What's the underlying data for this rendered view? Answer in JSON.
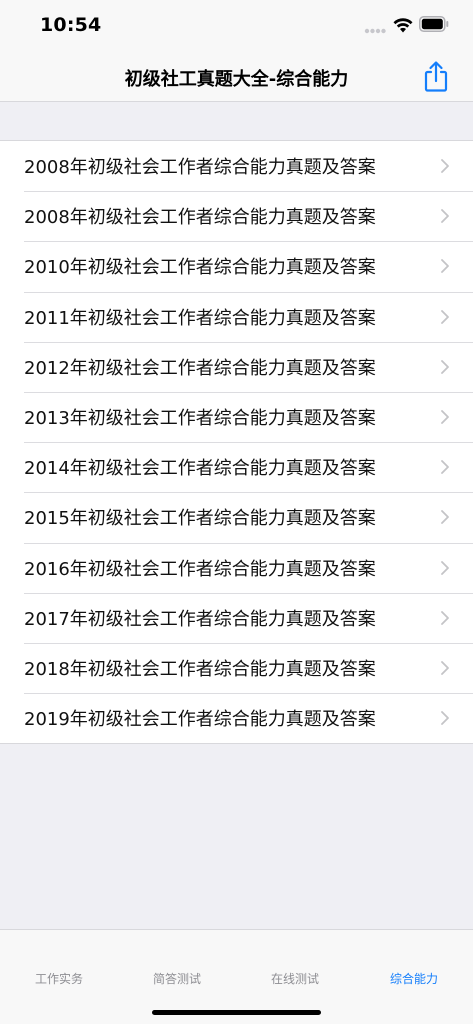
{
  "status_bar": {
    "time": "10:54"
  },
  "nav": {
    "title": "初级社工真题大全-综合能力",
    "share_icon": "share-icon",
    "accent_color": "#147efb"
  },
  "list": {
    "items": [
      {
        "label": "2008年初级社会工作者综合能力真题及答案"
      },
      {
        "label": "2008年初级社会工作者综合能力真题及答案"
      },
      {
        "label": "2010年初级社会工作者综合能力真题及答案"
      },
      {
        "label": "2011年初级社会工作者综合能力真题及答案"
      },
      {
        "label": "2012年初级社会工作者综合能力真题及答案"
      },
      {
        "label": "2013年初级社会工作者综合能力真题及答案"
      },
      {
        "label": "2014年初级社会工作者综合能力真题及答案"
      },
      {
        "label": "2015年初级社会工作者综合能力真题及答案"
      },
      {
        "label": "2016年初级社会工作者综合能力真题及答案"
      },
      {
        "label": "2017年初级社会工作者综合能力真题及答案"
      },
      {
        "label": "2018年初级社会工作者综合能力真题及答案"
      },
      {
        "label": "2019年初级社会工作者综合能力真题及答案"
      }
    ]
  },
  "tab_bar": {
    "tabs": [
      {
        "label": "工作实务",
        "active": false
      },
      {
        "label": "简答测试",
        "active": false
      },
      {
        "label": "在线测试",
        "active": false
      },
      {
        "label": "综合能力",
        "active": true
      }
    ]
  }
}
